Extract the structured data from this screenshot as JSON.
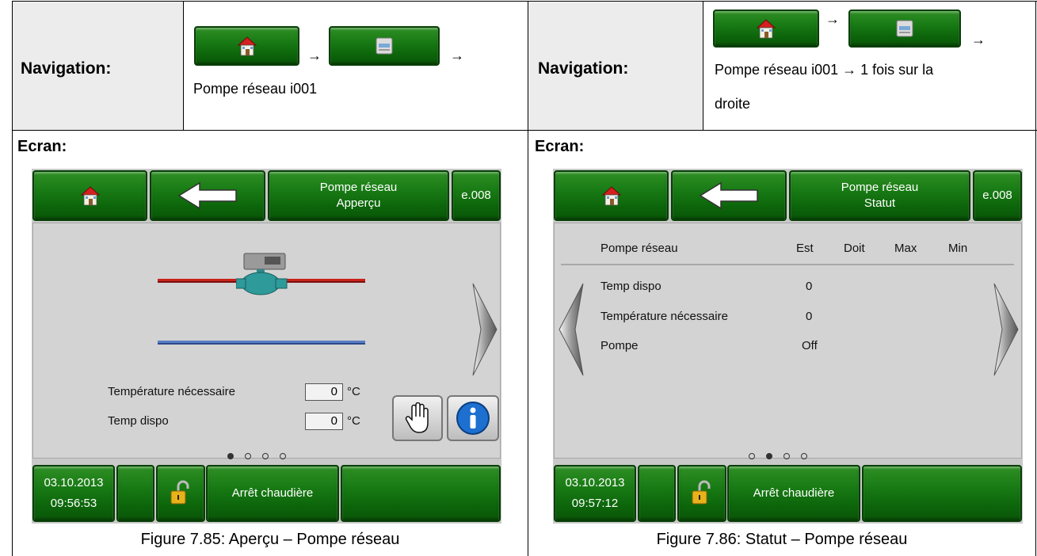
{
  "left_panel": {
    "nav_label": "Navigation:",
    "arrow1": "→",
    "arrow2": "→",
    "nav_path": "Pompe réseau i001",
    "ecran_label": "Ecran:",
    "screen": {
      "title_line1": "Pompe réseau",
      "title_line2": "Apperçu",
      "code": "e.008",
      "rows": [
        {
          "label": "Température nécessaire",
          "value": "0",
          "unit": "°C"
        },
        {
          "label": "Temp dispo",
          "value": "0",
          "unit": "°C"
        }
      ],
      "page_dots": [
        "on",
        "off",
        "off",
        "off"
      ],
      "footer": {
        "date": "03.10.2013",
        "time": "09:56:53",
        "status": "Arrêt chaudière"
      }
    },
    "caption": "Figure 7.85: Aperçu – Pompe réseau"
  },
  "right_panel": {
    "nav_label": "Navigation:",
    "arrow1": "→",
    "arrow2": "→",
    "nav_path_line1": "Pompe réseau i001 → 1 fois sur la",
    "nav_path_line2": "droite",
    "ecran_label": "Ecran:",
    "screen": {
      "title_line1": "Pompe réseau",
      "title_line2": "Statut",
      "code": "e.008",
      "headers": {
        "name": "Pompe réseau",
        "est": "Est",
        "doit": "Doit",
        "max": "Max",
        "min": "Min"
      },
      "rows": [
        {
          "label": "Temp dispo",
          "est": "0"
        },
        {
          "label": "Température nécessaire",
          "est": "0"
        },
        {
          "label": "Pompe",
          "est": "Off"
        }
      ],
      "page_dots": [
        "off",
        "on",
        "off",
        "off"
      ],
      "footer": {
        "date": "03.10.2013",
        "time": "09:57:12",
        "status": "Arrêt chaudière"
      }
    },
    "caption": "Figure 7.86: Statut – Pompe réseau"
  },
  "icons": [
    "house-icon",
    "printer-icon",
    "back-arrow-icon",
    "right-chevron-icon",
    "left-chevron-icon",
    "padlock-icon",
    "hand-icon",
    "info-icon",
    "pump-icon"
  ],
  "colors": {
    "button_green": "#187a14",
    "pipe_red": "#c8231c",
    "pipe_blue": "#5a7ec6",
    "cell_shade": "#ececec",
    "screen_grey": "#d3d3d3"
  }
}
